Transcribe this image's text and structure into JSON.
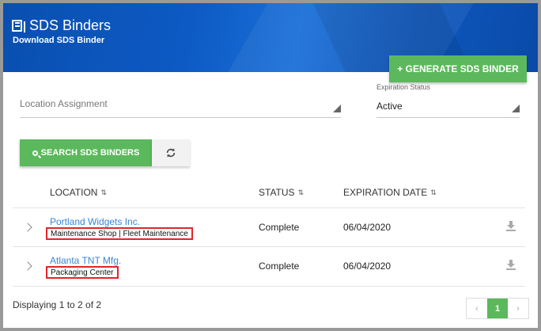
{
  "header": {
    "title": "SDS Binders",
    "subtitle": "Download SDS Binder",
    "generate_label": "+ GENERATE SDS BINDER"
  },
  "filters": {
    "location_placeholder": "Location Assignment",
    "expiration_label": "Expiration Status",
    "expiration_value": "Active"
  },
  "actions": {
    "search_label": "SEARCH SDS BINDERS"
  },
  "table": {
    "columns": [
      "LOCATION",
      "STATUS",
      "EXPIRATION DATE"
    ],
    "rows": [
      {
        "name": "Portland Widgets Inc.",
        "sub": "Maintenance Shop | Fleet Maintenance",
        "status": "Complete",
        "expiration": "06/04/2020"
      },
      {
        "name": "Atlanta TNT Mfg.",
        "sub": "Packaging Center",
        "status": "Complete",
        "expiration": "06/04/2020"
      }
    ]
  },
  "footer": {
    "display_text": "Displaying 1 to 2 of 2"
  },
  "pagination": {
    "prev": "‹",
    "current": "1",
    "next": "›"
  },
  "colors": {
    "banner": "#0d5ac4",
    "primary_button": "#5cb85c",
    "link": "#3a86d4",
    "highlight_box": "#e0252b"
  },
  "icons": {
    "title": "book-icon",
    "search": "search-icon",
    "refresh": "refresh-icon",
    "sort": "sort-icon",
    "expand": "chevron-right-icon",
    "download": "download-icon"
  }
}
